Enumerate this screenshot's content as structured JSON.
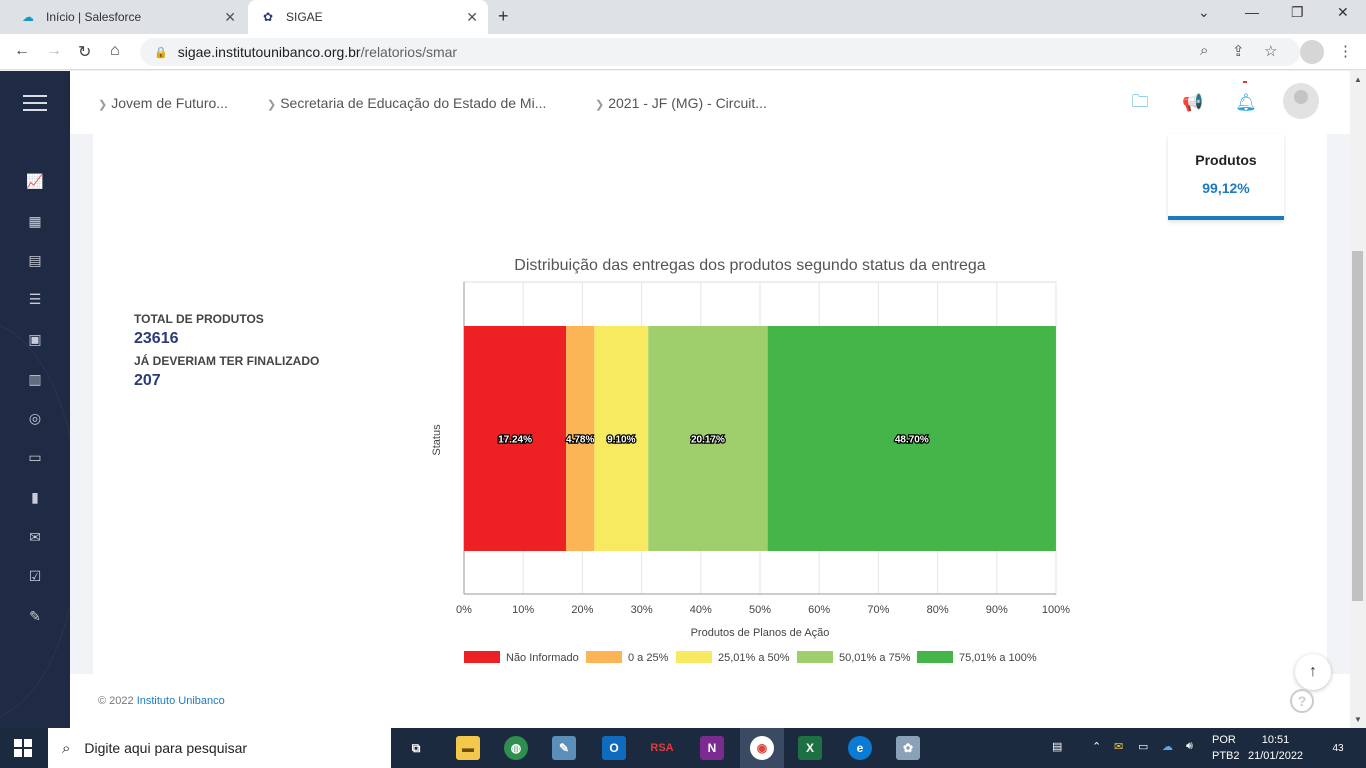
{
  "browser": {
    "tabs": [
      {
        "label": "Início | Salesforce",
        "icon": "salesforce-cloud-icon"
      },
      {
        "label": "SIGAE",
        "icon": "sigae-icon"
      }
    ],
    "url_host": "sigae.institutounibanco.org.br",
    "url_path": "/relatorios/smar"
  },
  "topbar": {
    "breadcrumbs": [
      "Jovem de Futuro...",
      "Secretaria de Educação do Estado de Mi...",
      "2021 - JF (MG) - Circuit..."
    ],
    "icons": [
      "folder-icon",
      "megaphone-icon",
      "bell-icon",
      "avatar"
    ],
    "colors": {
      "folder": "#29a3d8",
      "megaphone": "#f07c1e",
      "bell": "#29a3d8"
    }
  },
  "metric": {
    "label": "Produtos",
    "value": "99,12%"
  },
  "totals": {
    "total_label": "TOTAL DE PRODUTOS",
    "total_value": "23616",
    "late_label": "JÁ DEVERIAM TER FINALIZADO",
    "late_value": "207"
  },
  "chart_data": {
    "type": "bar",
    "orientation": "horizontal-stacked",
    "title": "Distribuição das entregas dos produtos segundo status da entrega",
    "xlabel": "Produtos de Planos de Ação",
    "ylabel": "Status",
    "xlim": [
      0,
      100
    ],
    "x_ticks": [
      "0%",
      "10%",
      "20%",
      "30%",
      "40%",
      "50%",
      "60%",
      "70%",
      "80%",
      "90%",
      "100%"
    ],
    "series": [
      {
        "name": "Não Informado",
        "value": 17.24,
        "label": "17.24%",
        "color": "#ed2024"
      },
      {
        "name": "0 a 25%",
        "value": 4.78,
        "label": "4.78%",
        "color": "#fbb456"
      },
      {
        "name": "25,01% a 50%",
        "value": 9.1,
        "label": "9.10%",
        "color": "#f7ea60"
      },
      {
        "name": "50,01% a 75%",
        "value": 20.17,
        "label": "20.17%",
        "color": "#9fcf6d"
      },
      {
        "name": "75,01% a 100%",
        "value": 48.7,
        "label": "48.70%",
        "color": "#44b649"
      }
    ],
    "grid": true,
    "legend": "bottom"
  },
  "footer": {
    "copyright": "© 2022",
    "link": "Instituto Unibanco"
  },
  "taskbar": {
    "search_placeholder": "Digite aqui para pesquisar",
    "lang_top": "POR",
    "lang_bottom": "PTB2",
    "time": "10:51",
    "date": "21/01/2022",
    "notifications": "43",
    "rsa_label": "RSA"
  }
}
